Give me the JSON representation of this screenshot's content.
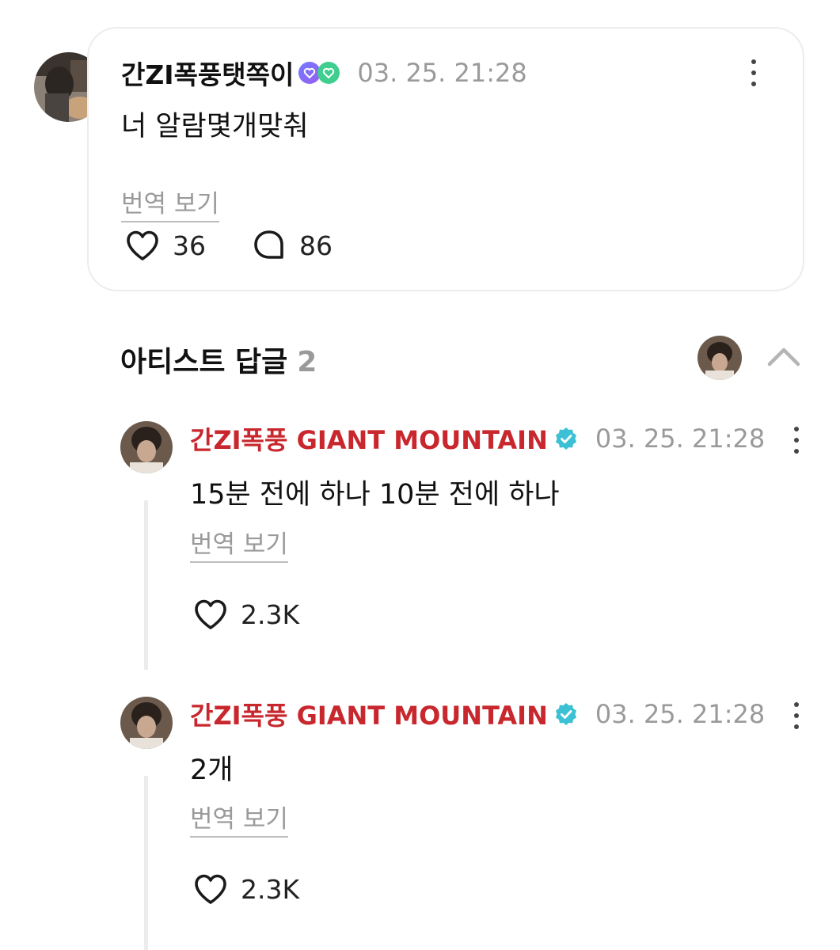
{
  "post": {
    "author": "간ZI폭풍탯쪽이",
    "timestamp": "03. 25. 21:28",
    "text": "너 알람몇개맞춰",
    "translate_label": "번역 보기",
    "likes": "36",
    "comments": "86",
    "badges": [
      "purple-heart-badge",
      "green-heart-badge"
    ]
  },
  "artist_replies": {
    "title": "아티스트 답글",
    "count": "2",
    "replies": [
      {
        "author": "간ZI폭풍 GIANT MOUNTAIN",
        "timestamp": "03. 25. 21:28",
        "text": "15분 전에 하나 10분 전에 하나",
        "translate_label": "번역 보기",
        "likes": "2.3K"
      },
      {
        "author": "간ZI폭풍 GIANT MOUNTAIN",
        "timestamp": "03. 25. 21:28",
        "text": "2개",
        "translate_label": "번역 보기",
        "likes": "2.3K"
      }
    ]
  },
  "colors": {
    "artist_name": "#c8272d",
    "verified_badge": "#3cc0d3",
    "muted_text": "#9a9a9a",
    "card_border": "#ececec"
  },
  "icons": [
    "heart-icon",
    "comment-bubble-icon",
    "more-vertical-icon",
    "chevron-up-icon",
    "verified-badge-icon"
  ]
}
